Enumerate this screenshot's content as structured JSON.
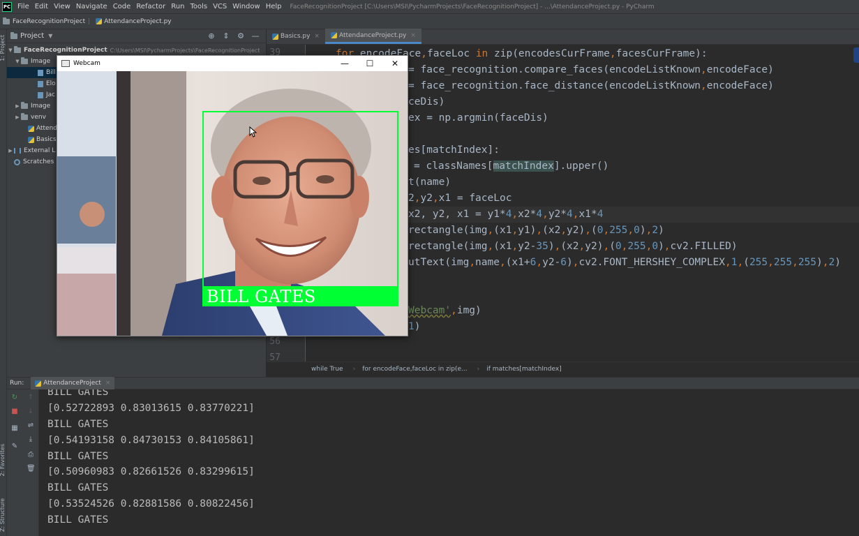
{
  "menubar": {
    "logo": "PC",
    "items": [
      "File",
      "Edit",
      "View",
      "Navigate",
      "Code",
      "Refactor",
      "Run",
      "Tools",
      "VCS",
      "Window",
      "Help"
    ],
    "window_title": "FaceRecognitionProject [C:\\Users\\MSI\\PycharmProjects\\FaceRecognitionProject] - ...\\AttendanceProject.py - PyCharm"
  },
  "navbar": {
    "project": "FaceRecognitionProject",
    "file": "AttendanceProject.py"
  },
  "left_strip": {
    "project_tab": "1: Project",
    "favorites_tab": "2: Favorites",
    "structure_tab": "Z: Structure"
  },
  "project_panel": {
    "title": "Project",
    "rows": [
      {
        "label": "FaceRecognitionProject",
        "path": "C:\\Users\\MSI\\PycharmProjects\\FaceRecognitionProject"
      },
      {
        "label": "Image"
      },
      {
        "label": "Bill"
      },
      {
        "label": "Elo"
      },
      {
        "label": "Jac"
      },
      {
        "label": "Image"
      },
      {
        "label": "venv"
      },
      {
        "label": "Attend"
      },
      {
        "label": "Basics"
      },
      {
        "label": "External L"
      },
      {
        "label": "Scratches"
      }
    ]
  },
  "editor": {
    "tabs": [
      {
        "label": "Basics.py"
      },
      {
        "label": "AttendanceProject.py"
      }
    ],
    "line_numbers": [
      "39",
      "56",
      "57"
    ],
    "code": {
      "l1_for": "for",
      "l1_a": " encodeFace",
      "l1_b": "faceLoc ",
      "l1_in": "in",
      "l1_c": " zip(encodesCurFrame",
      "l1_d": "facesCurFrame):",
      "l2_a": "= face_recognition.compare_faces(encodeListKnown",
      "l2_b": "encodeFace)",
      "l3_a": "= face_recognition.face_distance(encodeListKnown",
      "l3_b": "encodeFace)",
      "l4": "ceDis)",
      "l5": "ex = np.argmin(faceDis)",
      "l6": "es[matchIndex]:",
      "l7_a": "= classNames[",
      "l7_hl": "matchIndex",
      "l7_b": "].upper()",
      "l8": "t(name)",
      "l9_a": "2",
      "l9_b": "y2",
      "l9_c": "x1 = faceLoc",
      "l10_a": "x2, y2, x1 = y1*",
      "l10_n1": "4",
      "l10_b": "x2*",
      "l10_n2": "4",
      "l10_c": "y2*",
      "l10_n3": "4",
      "l10_d": "x1*",
      "l10_n4": "4",
      "l11_a": "rectangle(img",
      "l11_b": "(x1",
      "l11_c": "y1)",
      "l11_d": "(x2",
      "l11_e": "y2)",
      "l11_f": "(",
      "l11_n1": "0",
      "l11_n2": "255",
      "l11_n3": "0",
      "l11_g": ")",
      "l11_n4": "2",
      "l11_h": ")",
      "l12_a": "rectangle(img",
      "l12_b": "(x1",
      "l12_c": "y2-",
      "l12_n1": "35",
      "l12_d": ")",
      "l12_e": "(x2",
      "l12_f": "y2)",
      "l12_g": "(",
      "l12_n2": "0",
      "l12_n3": "255",
      "l12_n4": "0",
      "l12_h": ")",
      "l12_i": "cv2.FILLED)",
      "l13_a": "utText(img",
      "l13_b": "name",
      "l13_c": "(x1+",
      "l13_n1": "6",
      "l13_d": "y2-",
      "l13_n2": "6",
      "l13_e": ")",
      "l13_f": "cv2.FONT_HERSHEY_COMPLEX",
      "l13_n3": "1",
      "l13_g": "(",
      "l13_n4": "255",
      "l13_n5": "255",
      "l13_n6": "255",
      "l13_h": ")",
      "l13_n7": "2",
      "l13_i": ")",
      "l14_str": "Webcam'",
      "l14_b": "img)",
      "l15_n": "1",
      "l15_b": ")"
    },
    "breadcrumb": [
      "while True",
      "for encodeFace,faceLoc in zip(e...",
      "if matches[matchIndex]"
    ]
  },
  "run_panel": {
    "label": "Run:",
    "tab": "AttendanceProject",
    "console_lines": [
      "BILL GATES",
      "[0.52722893 0.83013615 0.83770221]",
      "BILL GATES",
      "[0.54193158 0.84730153 0.84105861]",
      "BILL GATES",
      "[0.50960983 0.82661526 0.83299615]",
      "BILL GATES",
      "[0.53524526 0.82881586 0.80822456]",
      "BILL GATES"
    ]
  },
  "webcam": {
    "title": "Webcam",
    "detected_name": "BILL GATES",
    "box_color": "#00ff33"
  }
}
